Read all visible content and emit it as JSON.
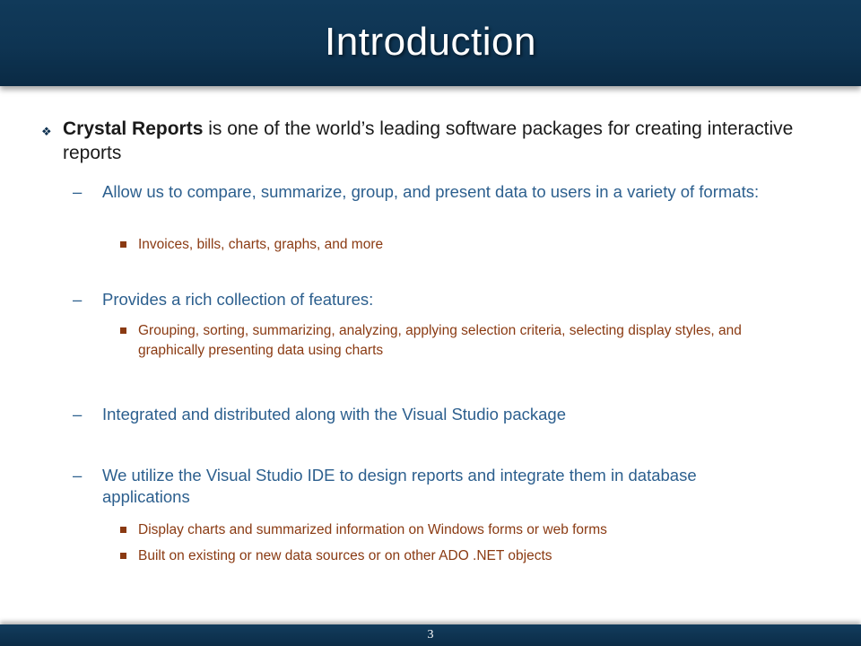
{
  "slide": {
    "title": "Introduction",
    "page_number": "3"
  },
  "bullets": {
    "main": {
      "bold": "Crystal Reports",
      "text": " is one of the world’s leading software packages for creating interactive reports"
    },
    "sub1": {
      "text": "Allow us to compare, summarize, group, and present data to users in a variety of formats:",
      "items": [
        "Invoices, bills, charts, graphs, and more"
      ]
    },
    "sub2": {
      "text": "Provides a rich collection of features:",
      "items": [
        "Grouping, sorting, summarizing, analyzing, applying selection criteria, selecting display styles, and graphically presenting data using charts"
      ]
    },
    "sub3": {
      "text": "Integrated and distributed along with the Visual Studio package"
    },
    "sub4": {
      "text": "We utilize the Visual Studio IDE to design reports and integrate them in database applications",
      "items": [
        "Display charts and summarized information on Windows forms or web forms",
        "Built on existing or new data sources or on other ADO .NET objects"
      ]
    }
  },
  "symbols": {
    "main_bullet": "❖",
    "dash": "–"
  }
}
